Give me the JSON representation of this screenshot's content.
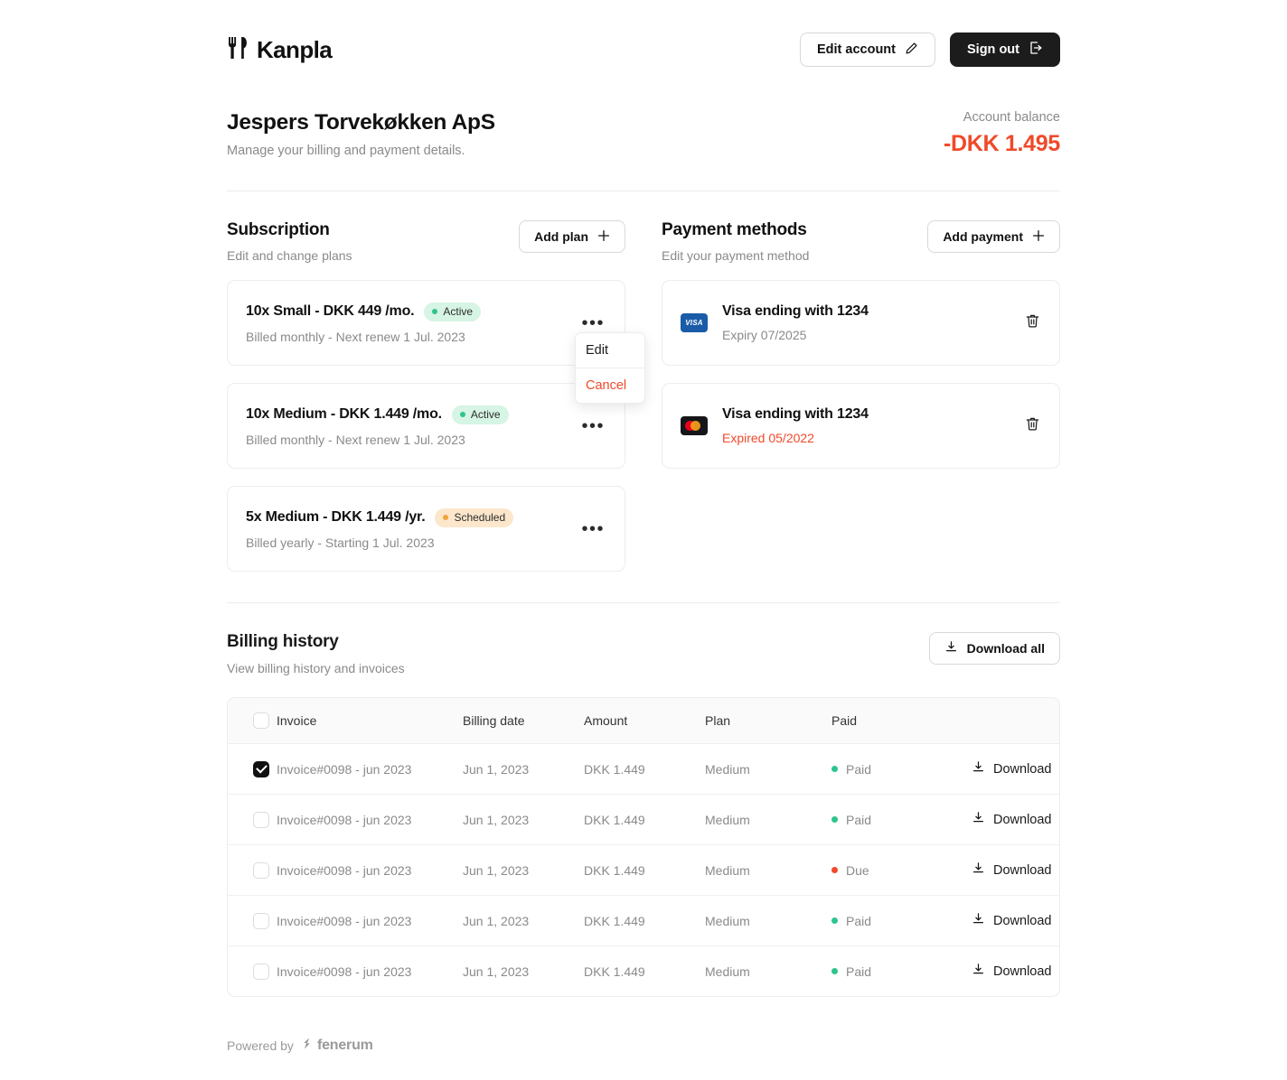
{
  "header": {
    "brand": "Kanpla",
    "logo_icon": "fork-knife-icon",
    "edit_account_label": "Edit account",
    "edit_account_icon": "pencil-icon",
    "sign_out_label": "Sign out",
    "sign_out_icon": "logout-icon"
  },
  "account": {
    "title": "Jespers Torvekøkken ApS",
    "subtitle": "Manage your billing and payment details.",
    "balance_label": "Account balance",
    "balance_value": "-DKK 1.495",
    "balance_color": "#ef4a29"
  },
  "subscription": {
    "title": "Subscription",
    "subtitle": "Edit and change plans",
    "add_label": "Add plan",
    "add_icon": "plus-icon",
    "menu_icon": "kebab-menu-icon",
    "plans": [
      {
        "title": "10x Small - DKK 449 /mo.",
        "status": "Active",
        "status_kind": "active",
        "detail": "Billed monthly - Next renew 1 Jul. 2023"
      },
      {
        "title": "10x Medium - DKK 1.449 /mo.",
        "status": "Active",
        "status_kind": "active",
        "detail": "Billed monthly - Next renew 1 Jul. 2023"
      },
      {
        "title": "5x Medium - DKK 1.449 /yr.",
        "status": "Scheduled",
        "status_kind": "scheduled",
        "detail": "Billed yearly - Starting 1 Jul. 2023"
      }
    ],
    "dropdown": {
      "edit_label": "Edit",
      "cancel_label": "Cancel"
    }
  },
  "payment_methods": {
    "title": "Payment methods",
    "subtitle": "Edit your payment method",
    "add_label": "Add payment",
    "add_icon": "plus-icon",
    "delete_icon": "trash-icon",
    "cards": [
      {
        "brand": "visa",
        "brand_label": "VISA",
        "title": "Visa ending with 1234",
        "detail": "Expiry 07/2025",
        "expired": false
      },
      {
        "brand": "mastercard",
        "brand_label": "",
        "title": "Visa ending with 1234",
        "detail": "Expired 05/2022",
        "expired": true
      }
    ]
  },
  "billing_history": {
    "title": "Billing history",
    "subtitle": "View billing history and invoices",
    "download_all_label": "Download all",
    "download_icon": "download-icon",
    "columns": [
      "Invoice",
      "Billing date",
      "Amount",
      "Plan",
      "Paid"
    ],
    "row_action_label": "Download",
    "rows": [
      {
        "checked": true,
        "invoice": "Invoice#0098 - jun 2023",
        "billing_date": "Jun 1, 2023",
        "amount": "DKK 1.449",
        "plan": "Medium",
        "paid_status": "Paid",
        "paid_kind": "paid"
      },
      {
        "checked": false,
        "invoice": "Invoice#0098 - jun 2023",
        "billing_date": "Jun 1, 2023",
        "amount": "DKK 1.449",
        "plan": "Medium",
        "paid_status": "Paid",
        "paid_kind": "paid"
      },
      {
        "checked": false,
        "invoice": "Invoice#0098 - jun 2023",
        "billing_date": "Jun 1, 2023",
        "amount": "DKK 1.449",
        "plan": "Medium",
        "paid_status": "Due",
        "paid_kind": "due"
      },
      {
        "checked": false,
        "invoice": "Invoice#0098 - jun 2023",
        "billing_date": "Jun 1, 2023",
        "amount": "DKK 1.449",
        "plan": "Medium",
        "paid_status": "Paid",
        "paid_kind": "paid"
      },
      {
        "checked": false,
        "invoice": "Invoice#0098 - jun 2023",
        "billing_date": "Jun 1, 2023",
        "amount": "DKK 1.449",
        "plan": "Medium",
        "paid_status": "Paid",
        "paid_kind": "paid"
      }
    ]
  },
  "footer": {
    "powered_by": "Powered by",
    "provider": "fenerum",
    "provider_icon": "bolt-icon"
  }
}
